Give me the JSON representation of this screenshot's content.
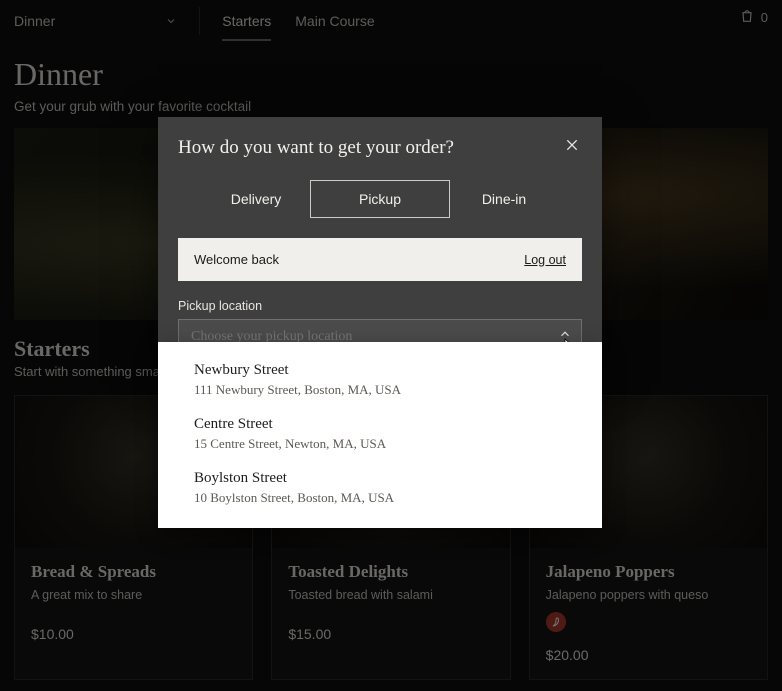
{
  "header": {
    "menu_label": "Dinner",
    "tabs": [
      {
        "label": "Starters",
        "active": true
      },
      {
        "label": "Main Course",
        "active": false
      }
    ],
    "bag_count": "0"
  },
  "page": {
    "title": "Dinner",
    "subtitle": "Get your grub with your favorite cocktail"
  },
  "section": {
    "title": "Starters",
    "subtitle": "Start with something small"
  },
  "products": [
    {
      "name": "Bread & Spreads",
      "desc": "A great mix to share",
      "price": "$10.00",
      "spicy": false
    },
    {
      "name": "Toasted Delights",
      "desc": "Toasted bread with salami",
      "price": "$15.00",
      "spicy": false
    },
    {
      "name": "Jalapeno Poppers",
      "desc": "Jalapeno poppers with queso",
      "price": "$20.00",
      "spicy": true
    }
  ],
  "modal": {
    "title": "How do you want to get your order?",
    "tabs": [
      {
        "label": "Delivery",
        "active": false
      },
      {
        "label": "Pickup",
        "active": true
      },
      {
        "label": "Dine-in",
        "active": false
      }
    ],
    "welcome": {
      "text": "Welcome back",
      "logout": "Log out"
    },
    "pickup": {
      "label": "Pickup location",
      "placeholder": "Choose your pickup location",
      "options": [
        {
          "name": "Newbury Street",
          "address": "111 Newbury Street, Boston, MA, USA"
        },
        {
          "name": "Centre Street",
          "address": "15 Centre Street, Newton, MA, USA"
        },
        {
          "name": "Boylston Street",
          "address": "10 Boylston Street, Boston, MA, USA"
        }
      ]
    }
  },
  "icons": {
    "chevron_down": "chevron-down",
    "chevron_up": "chevron-up",
    "bag": "shopping-bag",
    "close": "close",
    "spicy": "chili-pepper"
  },
  "colors": {
    "accent": "#b23b2e",
    "modal_bg": "#3f3f3f"
  }
}
